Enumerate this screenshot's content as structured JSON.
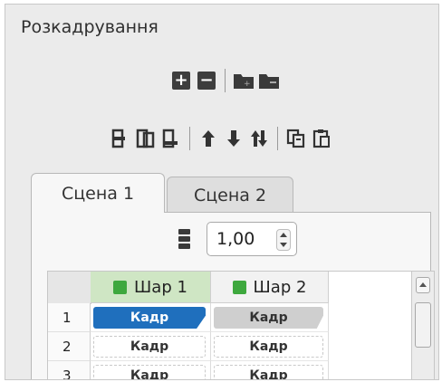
{
  "panel": {
    "title": "Розкадрування"
  },
  "toolbar1": {
    "icons": [
      "add-layer-icon",
      "remove-layer-icon",
      "add-folder-icon",
      "remove-folder-icon"
    ]
  },
  "toolbar2": {
    "icons": [
      "insert-frame-before-icon",
      "duplicate-frame-icon",
      "insert-frame-after-icon",
      "move-up-icon",
      "move-down-icon",
      "swap-icon",
      "copy-icon",
      "paste-icon"
    ]
  },
  "tabs": [
    {
      "label": "Сцена 1",
      "active": true
    },
    {
      "label": "Сцена 2",
      "active": false
    }
  ],
  "fps": {
    "value": "1,00"
  },
  "timeline": {
    "layers": [
      {
        "name": "Шар 1",
        "color": "#3ea83e",
        "selected": true
      },
      {
        "name": "Шар 2",
        "color": "#3ea83e",
        "selected": false
      }
    ],
    "rows": [
      {
        "num": "1",
        "cells": [
          "Кадр",
          "Кадр"
        ]
      },
      {
        "num": "2",
        "cells": [
          "Кадр",
          "Кадр"
        ]
      },
      {
        "num": "3",
        "cells": [
          "Кадр",
          "Кадр"
        ]
      }
    ]
  },
  "colors": {
    "selected_frame": "#1f6fbd",
    "layer_selected_bg": "#cfe6c4"
  }
}
